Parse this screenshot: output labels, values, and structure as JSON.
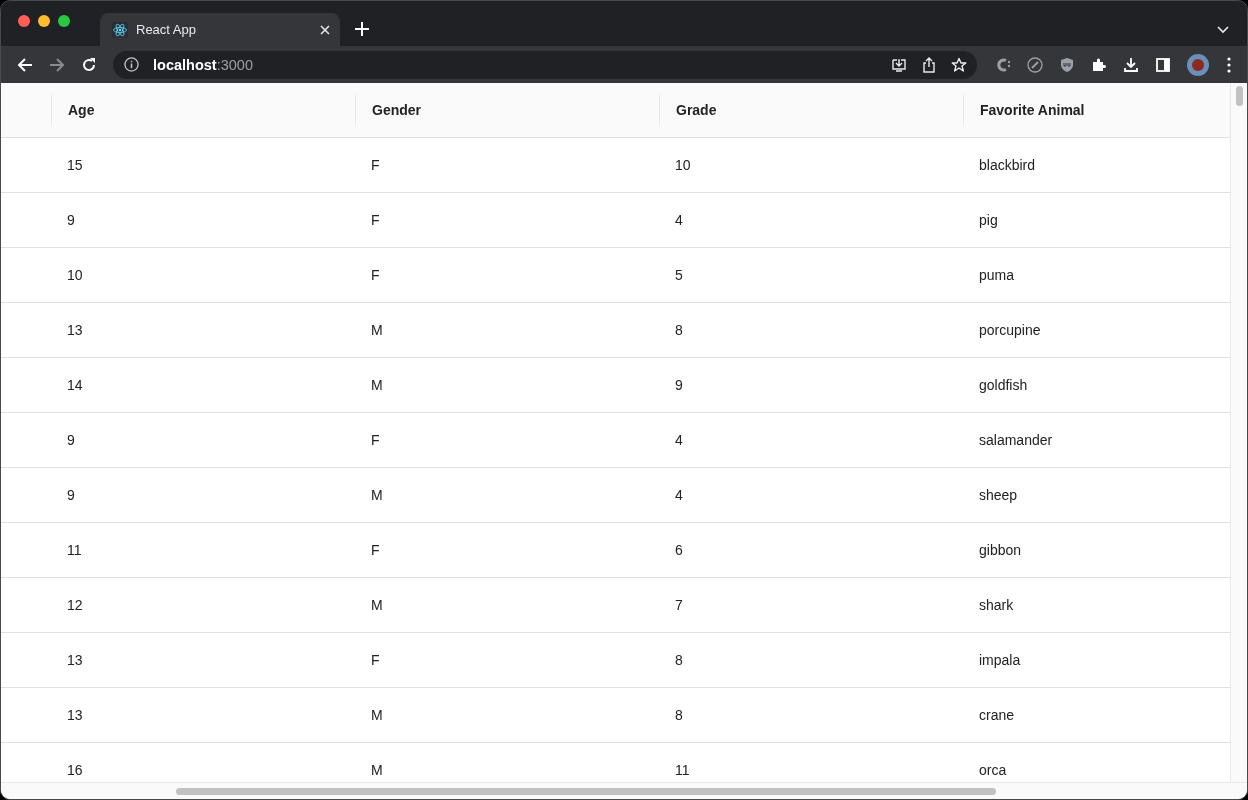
{
  "tab": {
    "title": "React App"
  },
  "address": {
    "host": "localhost",
    "port": ":3000"
  },
  "table": {
    "columns": [
      "Age",
      "Gender",
      "Grade",
      "Favorite Animal"
    ],
    "rows": [
      [
        "15",
        "F",
        "10",
        "blackbird"
      ],
      [
        "9",
        "F",
        "4",
        "pig"
      ],
      [
        "10",
        "F",
        "5",
        "puma"
      ],
      [
        "13",
        "M",
        "8",
        "porcupine"
      ],
      [
        "14",
        "M",
        "9",
        "goldfish"
      ],
      [
        "9",
        "F",
        "4",
        "salamander"
      ],
      [
        "9",
        "M",
        "4",
        "sheep"
      ],
      [
        "11",
        "F",
        "6",
        "gibbon"
      ],
      [
        "12",
        "M",
        "7",
        "shark"
      ],
      [
        "13",
        "F",
        "8",
        "impala"
      ],
      [
        "13",
        "M",
        "8",
        "crane"
      ],
      [
        "16",
        "M",
        "11",
        "orca"
      ]
    ]
  }
}
